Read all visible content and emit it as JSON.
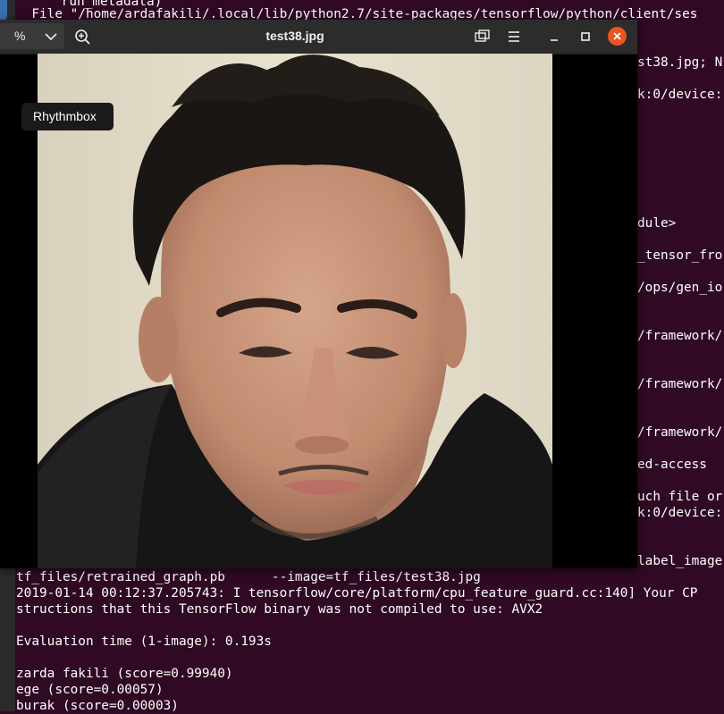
{
  "terminal": {
    "top_lines": [
      "    run_metadata)",
      "  File \"/home/ardafakili/.local/lib/python2.7/site-packages/tensorflow/python/client/ses"
    ],
    "right_fragments": [
      "st38.jpg; N",
      "k:0/device:",
      "dule>",
      "_tensor_fro",
      "/ops/gen_io",
      "/framework/",
      "/framework/",
      "/framework/",
      "ed-access",
      "uch file or",
      "k:0/device:",
      "label_image"
    ],
    "bottom_lines": [
      "tf_files/retrained_graph.pb      --image=tf_files/test38.jpg",
      "2019-01-14 00:12:37.205743: I tensorflow/core/platform/cpu_feature_guard.cc:140] Your CP",
      "structions that this TensorFlow binary was not compiled to use: AVX2",
      "",
      "Evaluation time (1-image): 0.193s",
      "",
      "zarda fakili (score=0.99940)",
      "ege (score=0.00057)",
      "burak (score=0.00003)"
    ]
  },
  "dock": {
    "tooltip": "Rhythmbox",
    "icons": [
      {
        "name": "files-app-icon",
        "color": "#3a6fb0"
      },
      {
        "name": "app-icon",
        "color": "#8a8a8a"
      },
      {
        "name": "rhythmbox-icon",
        "color": "#d7d7d7"
      },
      {
        "name": "libreoffice-writer-icon",
        "color": "#2a6fc9"
      },
      {
        "name": "software-center-icon",
        "color": "#e95420"
      },
      {
        "name": "help-icon",
        "color": "#3fa1e0"
      },
      {
        "name": "amazon-icon",
        "color": "#ffffff"
      },
      {
        "name": "terminal-icon",
        "color": "#4c4c4c"
      },
      {
        "name": "image-viewer-icon",
        "color": "#cfcfcf"
      }
    ]
  },
  "viewer": {
    "title": "test38.jpg",
    "zoom_label": "%",
    "accent": "#e95420"
  }
}
